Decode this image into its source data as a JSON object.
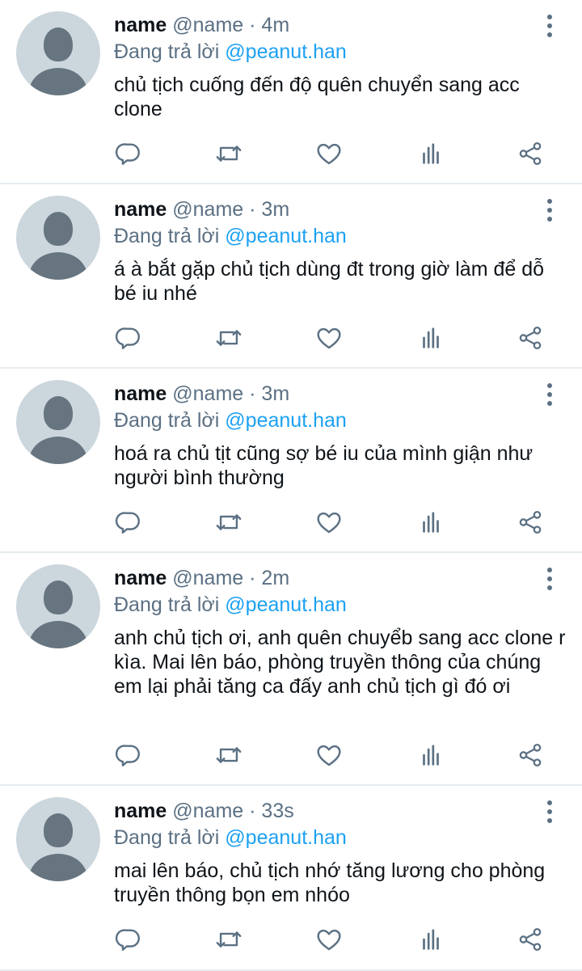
{
  "colors": {
    "text": "#0f1419",
    "secondary": "#5b7083",
    "link": "#1da1f2",
    "avatar_bg": "#ccd6dd",
    "avatar_fg": "#66757f",
    "divider": "#e6ecf0"
  },
  "icons": {
    "reply": "reply-icon",
    "retweet": "retweet-icon",
    "like": "heart-icon",
    "stats": "analytics-icon",
    "share": "share-icon",
    "more": "more-vertical-icon"
  },
  "replying_label": "Đang trả lời",
  "tweets": [
    {
      "name": "name",
      "handle": "@name",
      "separator": "·",
      "time": "4m",
      "reply_to": "@peanut.han",
      "text": "chủ tịch cuống đến độ quên chuyển sang acc clone"
    },
    {
      "name": "name",
      "handle": "@name",
      "separator": "·",
      "time": "3m",
      "reply_to": "@peanut.han",
      "text": "á à bắt gặp chủ tịch dùng đt trong giờ làm để dỗ bé iu nhé"
    },
    {
      "name": "name",
      "handle": "@name",
      "separator": "·",
      "time": "3m",
      "reply_to": "@peanut.han",
      "text": "hoá ra chủ tịt cũng sợ bé iu của mình giận như người bình thường"
    },
    {
      "name": "name",
      "handle": "@name",
      "separator": "·",
      "time": "2m",
      "reply_to": "@peanut.han",
      "text": "anh chủ tịch ơi, anh quên chuyểb sang acc clone r kìa. Mai lên báo, phòng truyền thông của chúng em lại phải tăng ca đấy anh chủ tịch gì đó ơi"
    },
    {
      "name": "name",
      "handle": "@name",
      "separator": "·",
      "time": "33s",
      "reply_to": "@peanut.han",
      "text": "mai lên báo, chủ tịch nhớ tăng lương cho phòng truyền thông bọn em nhóo"
    }
  ]
}
